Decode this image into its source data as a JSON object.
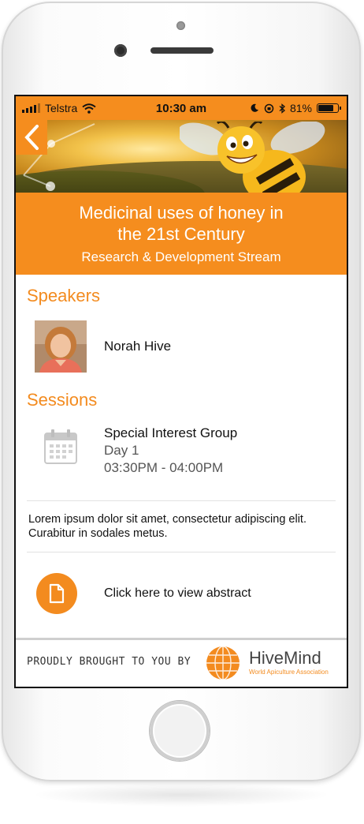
{
  "status_bar": {
    "carrier": "Telstra",
    "time": "10:30 am",
    "battery": "81%",
    "battery_level": 0.81
  },
  "header": {
    "title_line1": "Medicinal uses of honey in",
    "title_line2": "the 21st Century",
    "stream": "Research & Development Stream",
    "accent_color": "#f58d1e"
  },
  "speakers": {
    "heading": "Speakers",
    "items": [
      {
        "name": "Norah Hive"
      }
    ]
  },
  "sessions": {
    "heading": "Sessions",
    "items": [
      {
        "title": "Special Interest Group",
        "day": "Day 1",
        "time": "03:30PM - 04:00PM"
      }
    ]
  },
  "description": "Lorem ipsum dolor sit amet, consectetur adipiscing elit. Curabitur in sodales metus.",
  "abstract": {
    "label": "Click here to view abstract",
    "icon": "document-icon"
  },
  "footer": {
    "tagline": "PROUDLY BROUGHT TO YOU BY",
    "brand": "HiveMind",
    "brand_sub": "World Apiculture Association"
  }
}
